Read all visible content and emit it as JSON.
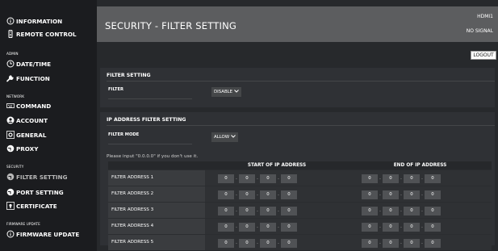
{
  "sidebar": {
    "items": [
      {
        "label": "INFORMATION",
        "icon": "info-icon"
      },
      {
        "label": "REMOTE CONTROL",
        "icon": "remote-icon"
      },
      {
        "label": "DATE/TIME",
        "icon": "clock-icon"
      },
      {
        "label": "FUNCTION",
        "icon": "wrench-icon"
      },
      {
        "label": "COMMAND",
        "icon": "keyboard-icon"
      },
      {
        "label": "ACCOUNT",
        "icon": "user-icon"
      },
      {
        "label": "GENERAL",
        "icon": "gear-icon"
      },
      {
        "label": "PROXY",
        "icon": "globe-icon"
      },
      {
        "label": "FILTER SETTING",
        "icon": "shield-icon"
      },
      {
        "label": "PORT SETTING",
        "icon": "globe-icon"
      },
      {
        "label": "CERTIFICATE",
        "icon": "certificate-icon"
      },
      {
        "label": "FIRMWARE UPDATE",
        "icon": "info-icon"
      }
    ],
    "sections": {
      "admin": "ADMIN",
      "network": "NETWORK",
      "security": "SECURITY",
      "firmware": "FIRMWARE UPDATE"
    }
  },
  "header": {
    "title": "SECURITY - FILTER SETTING",
    "input": "HDMI1",
    "signal": "NO SIGNAL"
  },
  "logout_label": "LOGOUT",
  "filter_setting": {
    "title": "FILTER SETTING",
    "filter_label": "FILTER",
    "filter_value": "DISABLE"
  },
  "ip_filter": {
    "title": "IP ADDRESS FILTER SETTING",
    "mode_label": "FILTER MODE",
    "mode_value": "ALLOW",
    "hint": "Please input \"0.0.0.0\" if you don't use it.",
    "col_start": "START OF IP ADDRESS",
    "col_end": "END OF IP ADDRESS",
    "rows": [
      {
        "label": "FILTER ADDRESS 1",
        "start": [
          "0",
          "0",
          "0",
          "0"
        ],
        "end": [
          "0",
          "0",
          "0",
          "0"
        ]
      },
      {
        "label": "FILTER ADDRESS 2",
        "start": [
          "0",
          "0",
          "0",
          "0"
        ],
        "end": [
          "0",
          "0",
          "0",
          "0"
        ]
      },
      {
        "label": "FILTER ADDRESS 3",
        "start": [
          "0",
          "0",
          "0",
          "0"
        ],
        "end": [
          "0",
          "0",
          "0",
          "0"
        ]
      },
      {
        "label": "FILTER ADDRESS 4",
        "start": [
          "0",
          "0",
          "0",
          "0"
        ],
        "end": [
          "0",
          "0",
          "0",
          "0"
        ]
      },
      {
        "label": "FILTER ADDRESS 5",
        "start": [
          "0",
          "0",
          "0",
          "0"
        ],
        "end": [
          "0",
          "0",
          "0",
          "0"
        ]
      }
    ]
  }
}
